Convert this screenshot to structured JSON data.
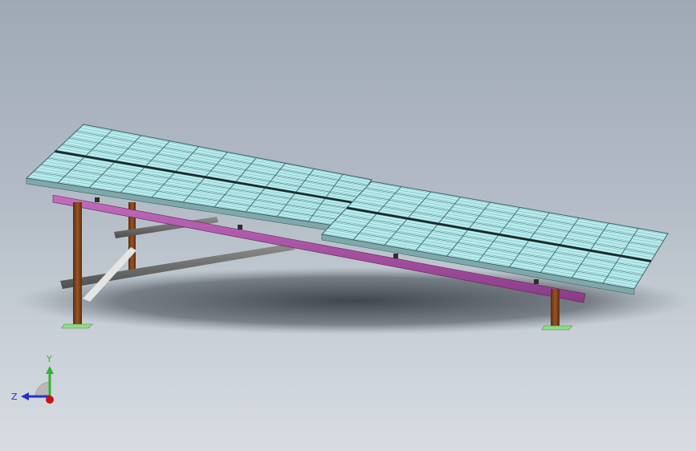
{
  "viewport": {
    "background_top": "#9fa9b6",
    "background_bottom": "#d7dce2"
  },
  "model": {
    "panel_color": "#b9eef0",
    "panel_edge_color": "#3d5f63",
    "beam_color": "#a34a9e",
    "post_color": "#7a3e17",
    "brace_color": "#6e6e6e",
    "footing_color": "#8fdc84"
  },
  "triad": {
    "y_label": "Y",
    "z_label": "Z",
    "y_color": "#2fb52f",
    "z_color": "#2233cc",
    "x_color": "#cc1111"
  }
}
